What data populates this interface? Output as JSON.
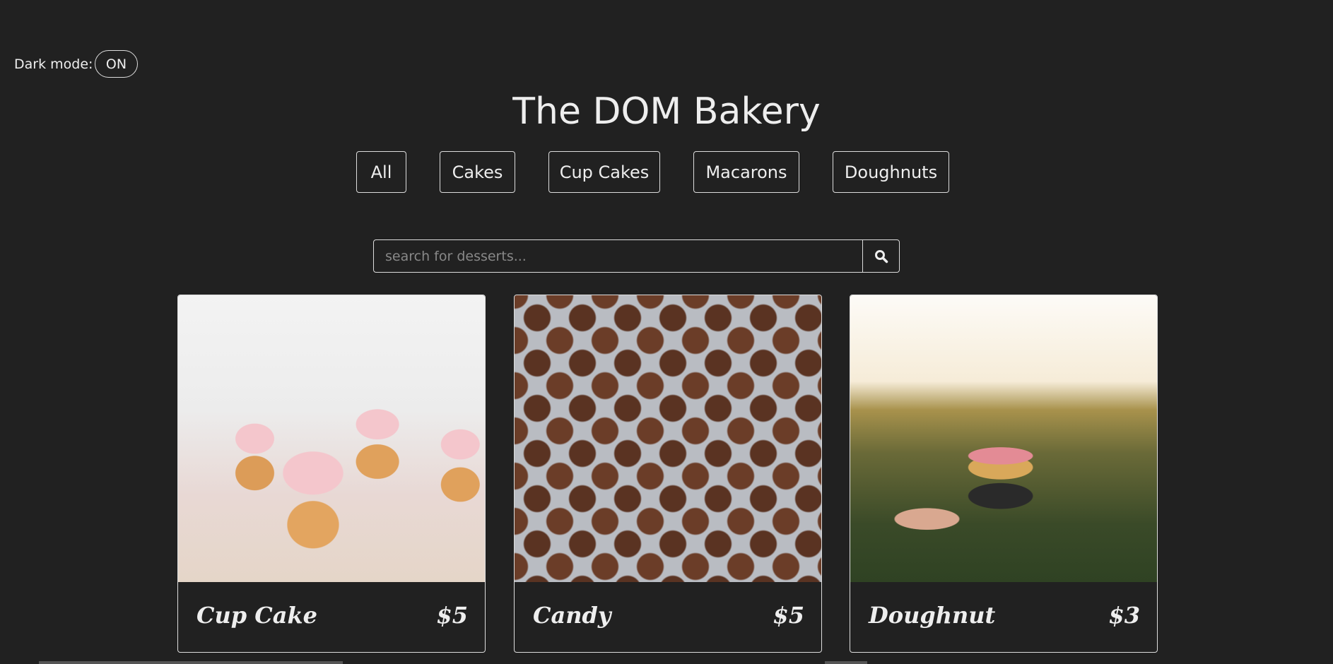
{
  "dark_mode": {
    "label": "Dark mode:",
    "toggle": "ON"
  },
  "title": "The DOM Bakery",
  "filters": [
    "All",
    "Cakes",
    "Cup Cakes",
    "Macarons",
    "Doughnuts"
  ],
  "search": {
    "placeholder": "search for desserts...",
    "value": "",
    "icon": "search-icon"
  },
  "products": [
    {
      "name": "Cup Cake",
      "price": "$5"
    },
    {
      "name": "Candy",
      "price": "$5"
    },
    {
      "name": "Doughnut",
      "price": "$3"
    }
  ]
}
